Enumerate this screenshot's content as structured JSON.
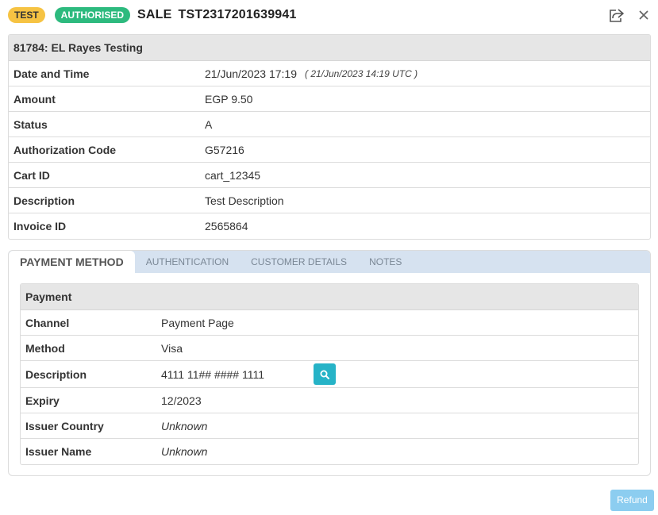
{
  "header": {
    "badge_test": "TEST",
    "badge_status": "AUTHORISED",
    "type": "SALE",
    "transaction_ref": "TST2317201639941",
    "icons": [
      "share-icon",
      "close-icon"
    ]
  },
  "details": {
    "title": "81784: EL Rayes Testing",
    "rows": [
      {
        "label": "Date and Time",
        "value": "21/Jun/2023 17:19",
        "extra": "( 21/Jun/2023 14:19 UTC )"
      },
      {
        "label": "Amount",
        "value": "EGP 9.50"
      },
      {
        "label": "Status",
        "value": "A"
      },
      {
        "label": "Authorization Code",
        "value": "G57216"
      },
      {
        "label": "Cart ID",
        "value": "cart_12345"
      },
      {
        "label": "Description",
        "value": "Test Description"
      },
      {
        "label": "Invoice ID",
        "value": "2565864"
      }
    ]
  },
  "tabs": [
    "PAYMENT METHOD",
    "AUTHENTICATION",
    "CUSTOMER DETAILS",
    "NOTES"
  ],
  "payment": {
    "title": "Payment",
    "rows": [
      {
        "label": "Channel",
        "value": "Payment Page"
      },
      {
        "label": "Method",
        "value": "Visa"
      },
      {
        "label": "Description",
        "value": "4111 11## #### 1111"
      },
      {
        "label": "Expiry",
        "value": "12/2023"
      },
      {
        "label": "Issuer Country",
        "value": "Unknown"
      },
      {
        "label": "Issuer Name",
        "value": "Unknown"
      }
    ]
  },
  "actions": {
    "refund_label": "Refund"
  },
  "colors": {
    "accent": "#26b3c7",
    "status_green": "#2dba7e",
    "test_yellow": "#f6c343",
    "link": "#2a7ab0",
    "refund": "#8ccdf0"
  }
}
